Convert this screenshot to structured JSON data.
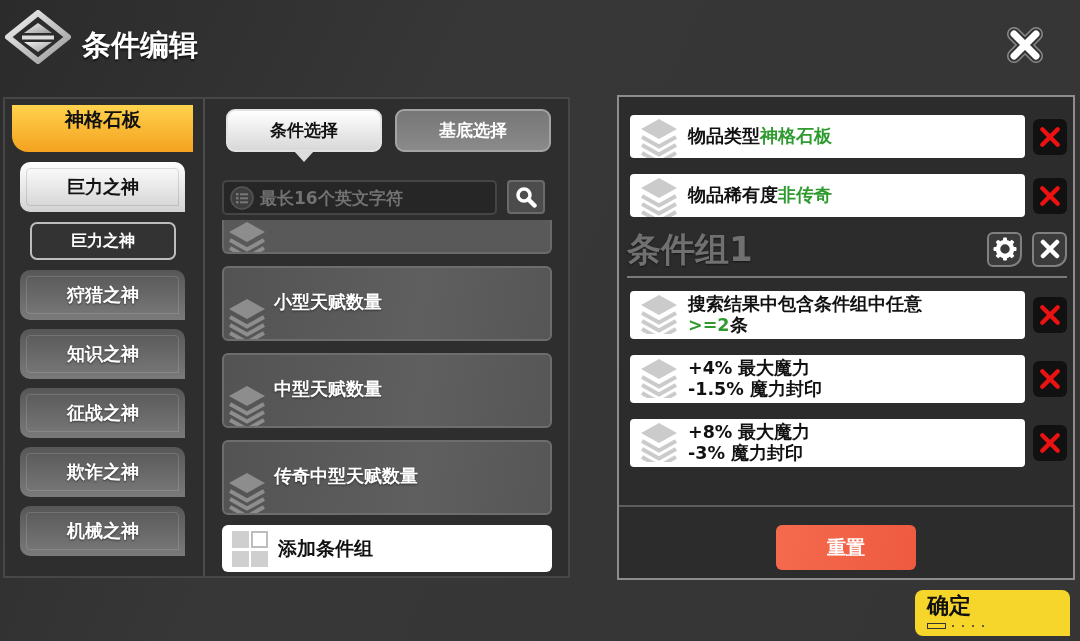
{
  "header": {
    "title": "条件编辑"
  },
  "sidebar": {
    "header": "神格石板",
    "items": [
      {
        "label": "巨力之神",
        "selected": true,
        "children": [
          {
            "label": "巨力之神",
            "selected": false
          }
        ]
      },
      {
        "label": "狩猎之神",
        "selected": false
      },
      {
        "label": "知识之神",
        "selected": false
      },
      {
        "label": "征战之神",
        "selected": false
      },
      {
        "label": "欺诈之神",
        "selected": false
      },
      {
        "label": "机械之神",
        "selected": false
      }
    ]
  },
  "selector": {
    "tabs": [
      {
        "label": "条件选择",
        "selected": true
      },
      {
        "label": "基底选择",
        "selected": false
      }
    ],
    "search": {
      "placeholder": "最长16个英文字符"
    },
    "options": [
      {
        "kind": "clipped"
      },
      {
        "kind": "full",
        "label": "小型天赋数量"
      },
      {
        "kind": "full",
        "label": "中型天赋数量"
      },
      {
        "kind": "full",
        "label": "传奇中型天赋数量"
      }
    ],
    "add_group_button": "添加条件组"
  },
  "conditions": [
    {
      "lines": [
        {
          "segments": [
            {
              "text": "物品类型",
              "highlight": false
            },
            {
              "text": "神格石板",
              "highlight": true
            }
          ]
        }
      ]
    },
    {
      "lines": [
        {
          "segments": [
            {
              "text": "物品稀有度",
              "highlight": false
            },
            {
              "text": "非传奇",
              "highlight": true
            }
          ]
        }
      ]
    }
  ],
  "groups": [
    {
      "title": "条件组1",
      "conditions": [
        {
          "lines": [
            {
              "segments": [
                {
                  "text": "搜索结果中包含条件组中任意",
                  "highlight": false
                }
              ]
            },
            {
              "segments": [
                {
                  "text": ">=2",
                  "highlight": true
                },
                {
                  "text": "条",
                  "highlight": false
                }
              ]
            }
          ]
        },
        {
          "lines": [
            {
              "segments": [
                {
                  "text": "+4% 最大魔力",
                  "highlight": false
                }
              ]
            },
            {
              "segments": [
                {
                  "text": "-1.5% 魔力封印",
                  "highlight": false
                }
              ]
            }
          ]
        },
        {
          "lines": [
            {
              "segments": [
                {
                  "text": "+8% 最大魔力",
                  "highlight": false
                }
              ]
            },
            {
              "segments": [
                {
                  "text": "-3% 魔力封印",
                  "highlight": false
                }
              ]
            }
          ]
        }
      ]
    }
  ],
  "reset_button": "重置",
  "confirm_button": "确定"
}
